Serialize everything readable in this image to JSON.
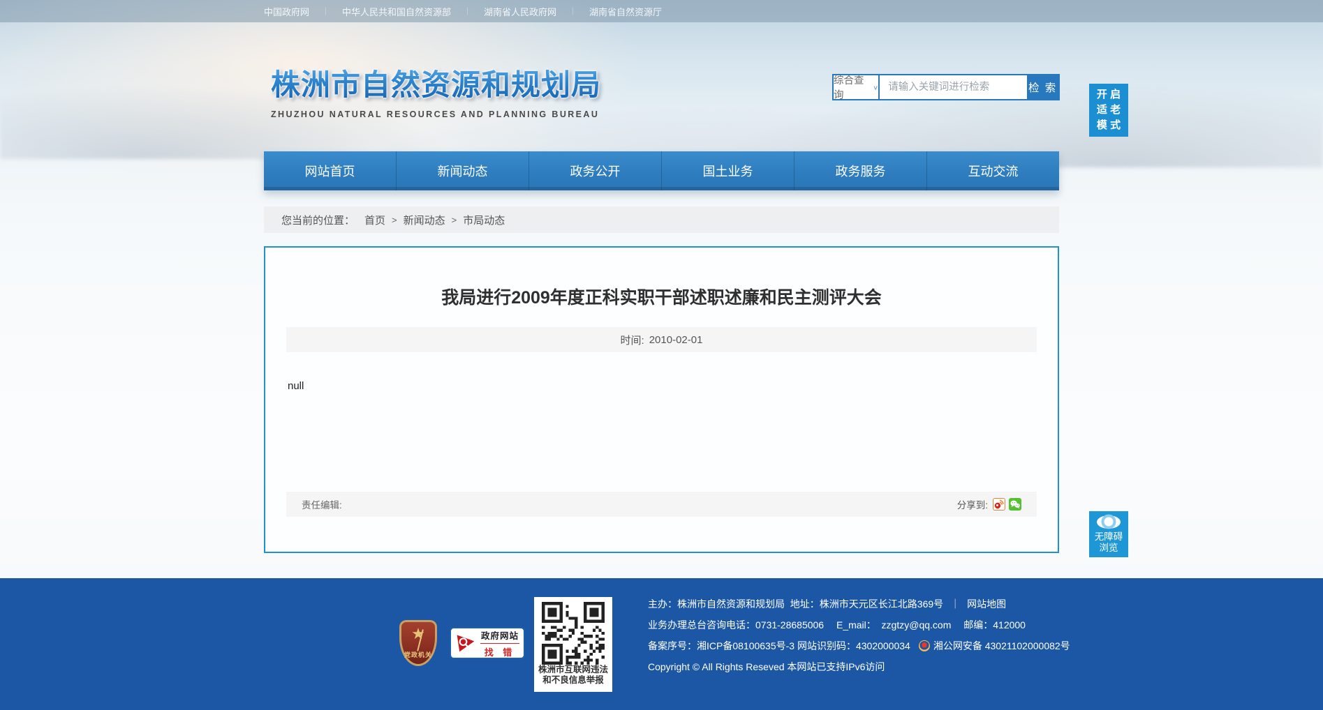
{
  "colors": {
    "nav_blue": "#2e7dbf",
    "accent_blue": "#2878be",
    "side_button_blue": "#1b8fd2",
    "footer_blue": "#1c57a5",
    "article_border_blue": "#2191cf"
  },
  "topbar": {
    "links": [
      "中国政府网",
      "中华人民共和国自然资源部",
      "湖南省人民政府网",
      "湖南省自然资源厅"
    ]
  },
  "header": {
    "site_title": "株洲市自然资源和规划局",
    "site_subtitle": "ZHUZHOU NATURAL RESOURCES AND PLANNING BUREAU",
    "search": {
      "category": "综合查询",
      "chevron": "∨",
      "placeholder": "请输入关键词进行检索",
      "button_label": "检 索"
    },
    "elder_mode": {
      "line1": "开 启",
      "line2": "适 老",
      "line3": "模 式"
    }
  },
  "nav": {
    "items": [
      "网站首页",
      "新闻动态",
      "政务公开",
      "国土业务",
      "政务服务",
      "互动交流"
    ]
  },
  "breadcrumb": {
    "label": "您当前的位置：",
    "home": "首页",
    "sep1": ">",
    "section": "新闻动态",
    "sep2": ">",
    "current": "市局动态"
  },
  "article": {
    "title": "我局进行2009年度正科实职干部述职述廉和民主测评大会",
    "time_label": "时间:",
    "time_value": "2010-02-01",
    "body_text": "null",
    "editor_label": "责任编辑:",
    "share_label": "分享到:",
    "share_icons": [
      "weibo-icon",
      "wechat-icon"
    ]
  },
  "accessibility": {
    "line1": "无障碍",
    "line2": "浏览"
  },
  "footer": {
    "party_badge_label": "党政机关",
    "find_error": {
      "line1": "政府网站",
      "line2": "找 错"
    },
    "qr_caption1": "株洲市互联网违法",
    "qr_caption2": "和不良信息举报",
    "line1_main": "主办：株洲市自然资源和规划局  地址：株洲市天元区长江北路369号",
    "line1_sep": "｜",
    "line1_link": "网站地图",
    "line2": "业务办理总台咨询电话：0731-28685006　 E_mail：  zzgtzy@qq.com　 邮编：412000",
    "line3_icp": "备案序号：湘ICP备08100635号-3 网站识别码：4302000034",
    "line3_police": "湘公网安备 43021102000082号",
    "line4": "Copyright © All Rights Reseved 本网站已支持IPv6访问"
  }
}
